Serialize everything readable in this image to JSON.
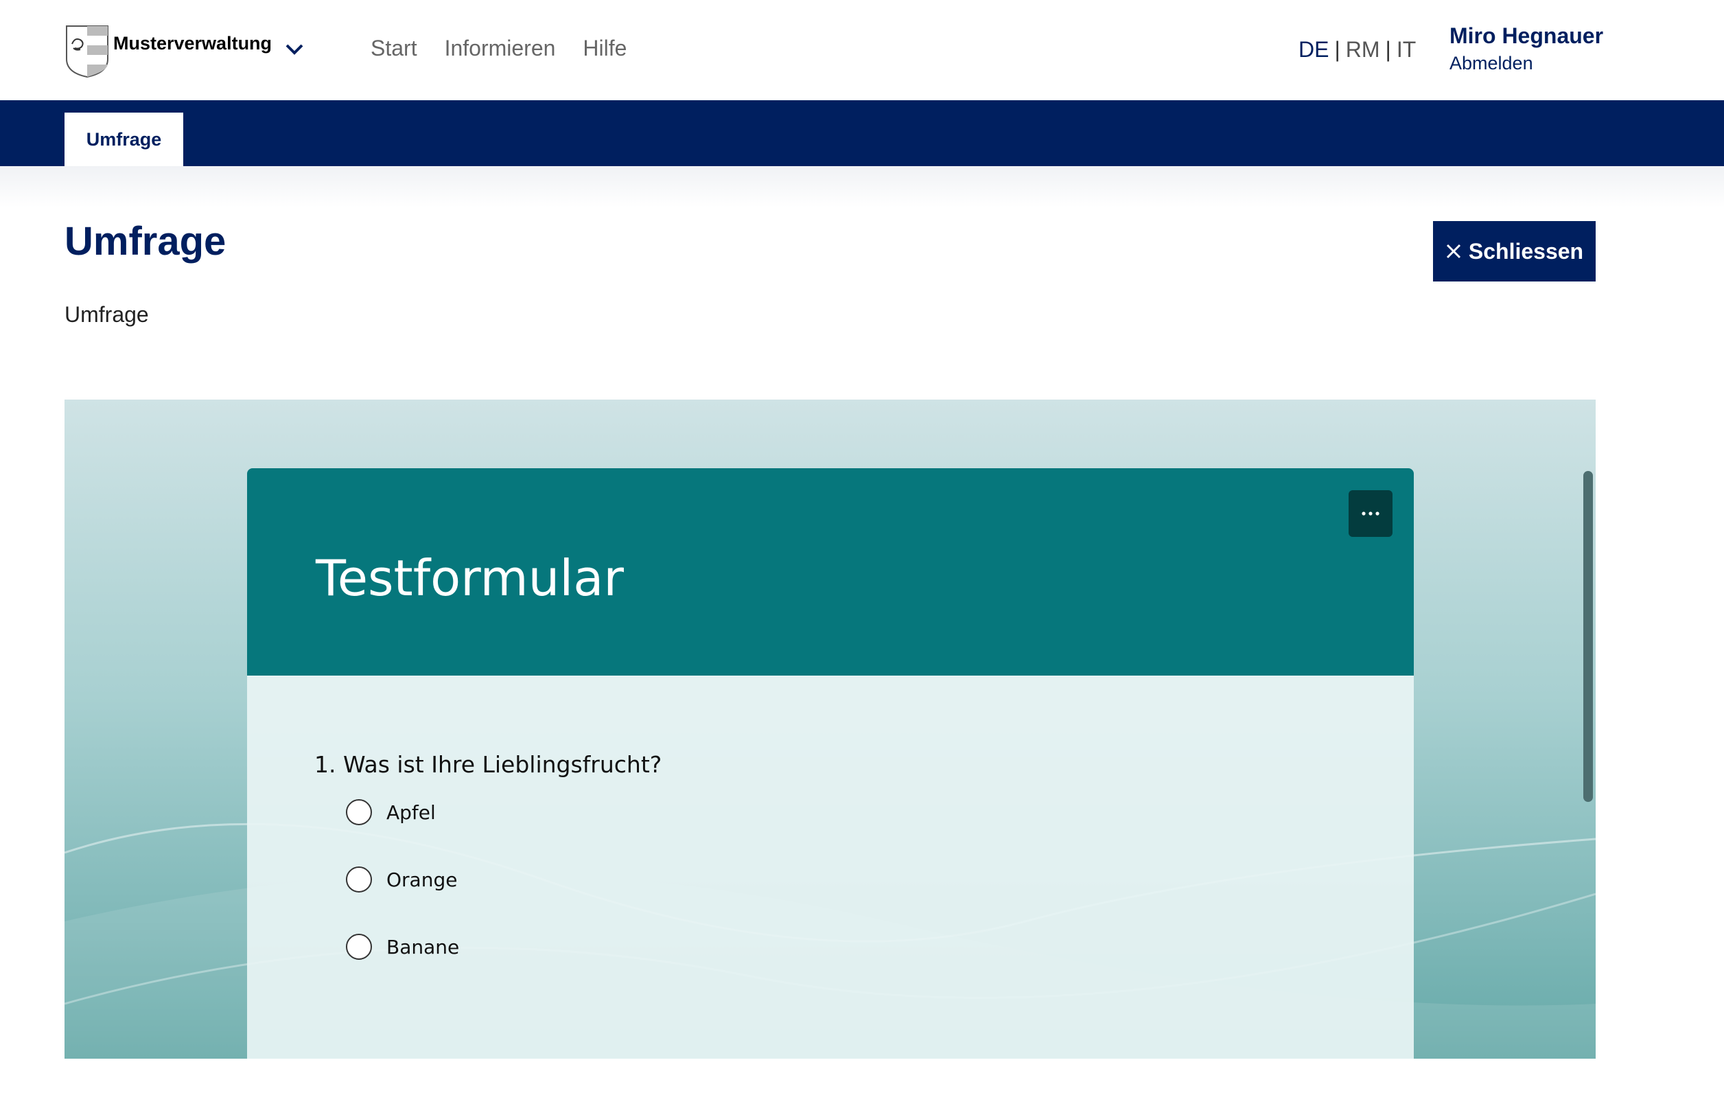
{
  "header": {
    "org_name": "Musterverwaltung",
    "nav": [
      "Start",
      "Informieren",
      "Hilfe"
    ],
    "languages": [
      "DE",
      "RM",
      "IT"
    ],
    "active_language": "DE",
    "user_name": "Miro Hegnauer",
    "logout_label": "Abmelden"
  },
  "tabs": {
    "active": "Umfrage"
  },
  "page": {
    "title": "Umfrage",
    "subtitle": "Umfrage",
    "close_label": "Schliessen"
  },
  "form": {
    "title": "Testformular",
    "question_number": "1.",
    "question": "Was ist Ihre Lieblingsfrucht?",
    "options": [
      "Apfel",
      "Orange",
      "Banane"
    ]
  },
  "colors": {
    "navy": "#001f5f",
    "teal_header": "#06777c",
    "teal_dark": "#033c3e"
  }
}
